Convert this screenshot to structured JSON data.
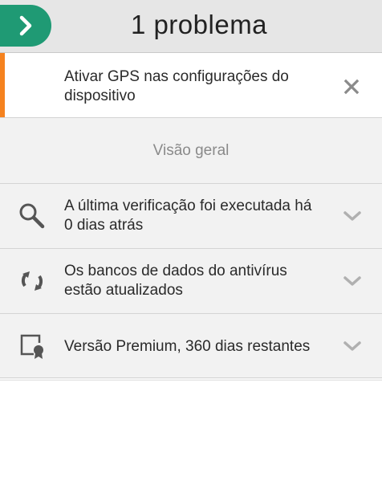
{
  "header": {
    "title": "1 problema",
    "back_icon": "chevron-right-icon",
    "accent_color": "#1f9a74"
  },
  "problem": {
    "text": "Ativar GPS nas configurações do dispositivo",
    "accent_color": "#f5821f",
    "close_icon": "close-icon"
  },
  "overview": {
    "label": "Visão geral"
  },
  "items": [
    {
      "text": "A última verificação foi executada há 0 dias atrás",
      "icon": "search-icon"
    },
    {
      "text": "Os bancos de dados do antivírus estão atualizados",
      "icon": "refresh-icon"
    },
    {
      "text": "Versão Premium, 360 dias restantes",
      "icon": "premium-certificate-icon"
    }
  ]
}
